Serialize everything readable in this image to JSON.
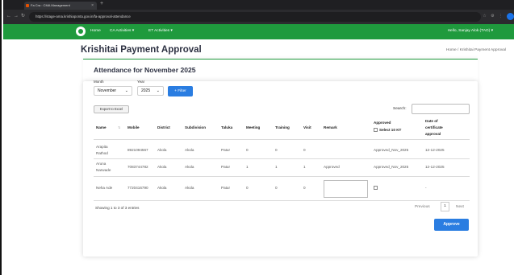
{
  "browser": {
    "tab_title": "Fa Cra : CMA Management",
    "url": "https://stage-ama.krishiaponta.gov.in/fa-approval-attendance",
    "icons": [
      "back-icon",
      "forward-icon",
      "reload-icon",
      "star-icon",
      "extensions-icon",
      "profile-icon"
    ]
  },
  "nav": {
    "home": "Home",
    "ca_activities": "CA Activities ▾",
    "et_activities": "ET Activities ▾",
    "user": "Hello, Sanjay Alok (TAO) ▾"
  },
  "page": {
    "title": "Krishitai Payment Approval",
    "breadcrumb": "Home / Krishitai Payment Approval"
  },
  "card": {
    "title": "Attendance for November 2025",
    "month_label": "Month",
    "year_label": "Year",
    "month_value": "November",
    "year_value": "2025",
    "filter_label": "+ Filter",
    "export_label": "Export to Excel",
    "search_label": "Search:"
  },
  "table": {
    "headers": {
      "name": "Name",
      "mobile": "Mobile",
      "district": "District",
      "subdivision": "Subdivision",
      "taluka": "Taluka",
      "meeting": "Meeting",
      "training": "Training",
      "visit": "Visit",
      "remark": "Remark",
      "approved_1": "Approved",
      "approved_2": "Select 10 KT",
      "doc_1": "Date of",
      "doc_2": "certificate",
      "doc_3": "approval"
    },
    "rows": [
      {
        "name_1": "Arapita",
        "name_2": "Rathod",
        "mobile": "8921094567",
        "district": "Akola",
        "subdivision": "Akola",
        "taluka": "Patur",
        "meeting": "0",
        "training": "0",
        "visit": "0",
        "remark": "",
        "approved": "Approved_Nov_2025",
        "date": "12-12-2025"
      },
      {
        "name_1": "Aruna",
        "name_2": "Narwade",
        "mobile": "7083744782",
        "district": "Akola",
        "subdivision": "Akola",
        "taluka": "Patur",
        "meeting": "1",
        "training": "1",
        "visit": "1",
        "remark": "Approved",
        "approved": "Approved_Nov_2025",
        "date": "12-12-2025"
      },
      {
        "name_1": "Neha Ade",
        "name_2": "",
        "mobile": "7720416790",
        "district": "Akola",
        "subdivision": "Akola",
        "taluka": "Patur",
        "meeting": "0",
        "training": "0",
        "visit": "0",
        "remark": "",
        "approved": "",
        "date": "-"
      }
    ]
  },
  "footer": {
    "info": "Showing 1 to 3 of 3 entries",
    "previous": "Previous",
    "page": "1",
    "next": "Next",
    "approve": "Approve"
  },
  "colors": {
    "nav_green": "#1f9a3d",
    "button_blue": "#2a7de1"
  }
}
